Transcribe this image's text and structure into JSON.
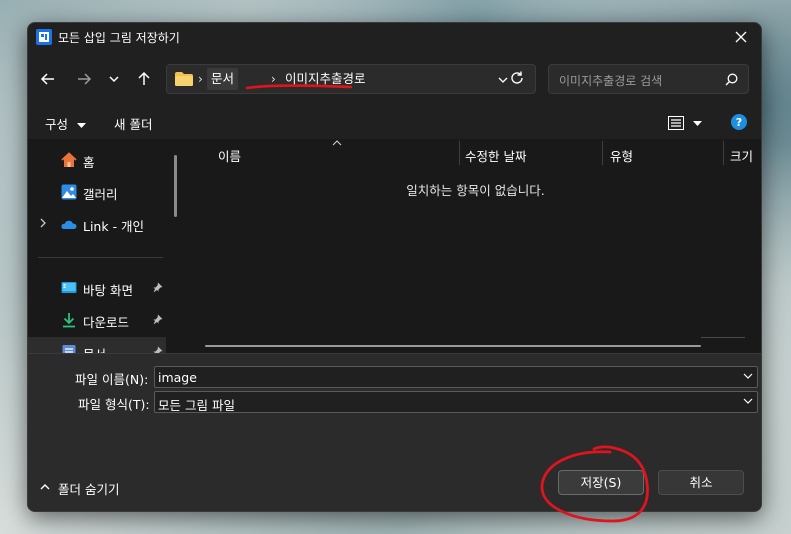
{
  "window": {
    "title": "모든 삽입 그림 저장하기",
    "close_icon": "close-icon"
  },
  "nav": {
    "back_icon": "arrow-left-icon",
    "forward_icon": "arrow-right-icon",
    "recent_icon": "chevron-down-icon",
    "up_icon": "arrow-up-icon"
  },
  "address": {
    "crumbs": [
      "문서",
      "이미지추출경로"
    ],
    "refresh_icon": "refresh-icon"
  },
  "search": {
    "placeholder": "이미지추출경로 검색"
  },
  "commandbar": {
    "organize_label": "구성",
    "new_folder_label": "새 폴더",
    "view_icon": "list-view-icon",
    "help_icon": "help-icon",
    "help_glyph": "?"
  },
  "sidebar": {
    "items": [
      {
        "label": "홈",
        "icon": "home-icon"
      },
      {
        "label": "갤러리",
        "icon": "gallery-icon"
      },
      {
        "label": "Link - 개인",
        "icon": "onedrive-cloud-icon"
      },
      {
        "label": "바탕 화면",
        "icon": "desktop-icon"
      },
      {
        "label": "다운로드",
        "icon": "download-icon"
      },
      {
        "label": "문서",
        "icon": "documents-icon"
      }
    ]
  },
  "filelist": {
    "columns": [
      "이름",
      "수정한 날짜",
      "유형",
      "크기"
    ],
    "empty_message": "일치하는 항목이 없습니다."
  },
  "form": {
    "filename_label": "파일 이름(N):",
    "filename_value": "image",
    "filetype_label": "파일 형식(T):",
    "filetype_value": "모든 그림 파일"
  },
  "footer": {
    "hide_folders_label": "폴더 숨기기",
    "save_label": "저장(S)",
    "cancel_label": "취소"
  },
  "colors": {
    "dialog_bg": "#202020",
    "accent_blue": "#1e8fe0",
    "annotation_red": "#e0141e"
  }
}
